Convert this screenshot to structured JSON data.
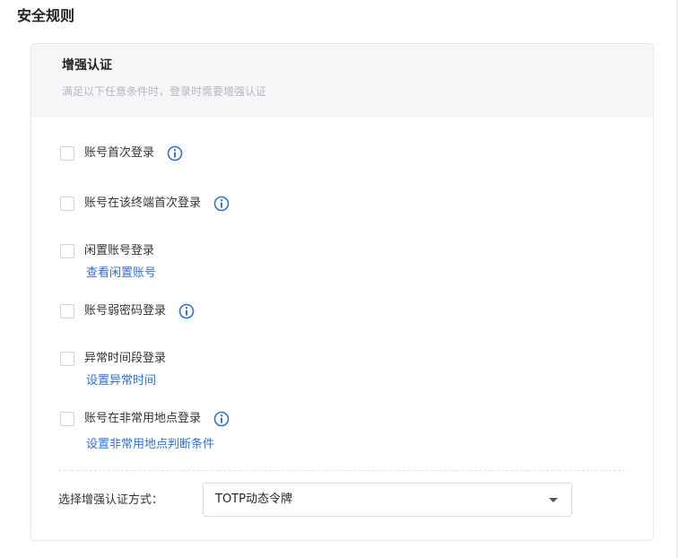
{
  "page": {
    "title": "安全规则"
  },
  "card": {
    "title": "增强认证",
    "subtitle": "满足以下任意条件时，登录时需要增强认证"
  },
  "options": [
    {
      "label": "账号首次登录",
      "checked": false,
      "has_info_icon": true
    },
    {
      "label": "账号在该终端首次登录",
      "checked": false,
      "has_info_icon": true
    },
    {
      "label": "闲置账号登录",
      "checked": false,
      "has_info_icon": false,
      "link": "查看闲置账号"
    },
    {
      "label": "账号弱密码登录",
      "checked": false,
      "has_info_icon": true
    },
    {
      "label": "异常时间段登录",
      "checked": false,
      "has_info_icon": false,
      "link": "设置异常时间"
    },
    {
      "label": "账号在非常用地点登录",
      "checked": false,
      "has_info_icon": true,
      "link": "设置非常用地点判断条件"
    }
  ],
  "method": {
    "label": "选择增强认证方式：",
    "selected": "TOTP动态令牌"
  },
  "colors": {
    "link": "#2f6fde",
    "info_icon": "#2f6fde",
    "header_bg": "#f5f6f8"
  },
  "icons": {
    "info": "info-circle-icon",
    "dropdown": "caret-down-icon"
  }
}
